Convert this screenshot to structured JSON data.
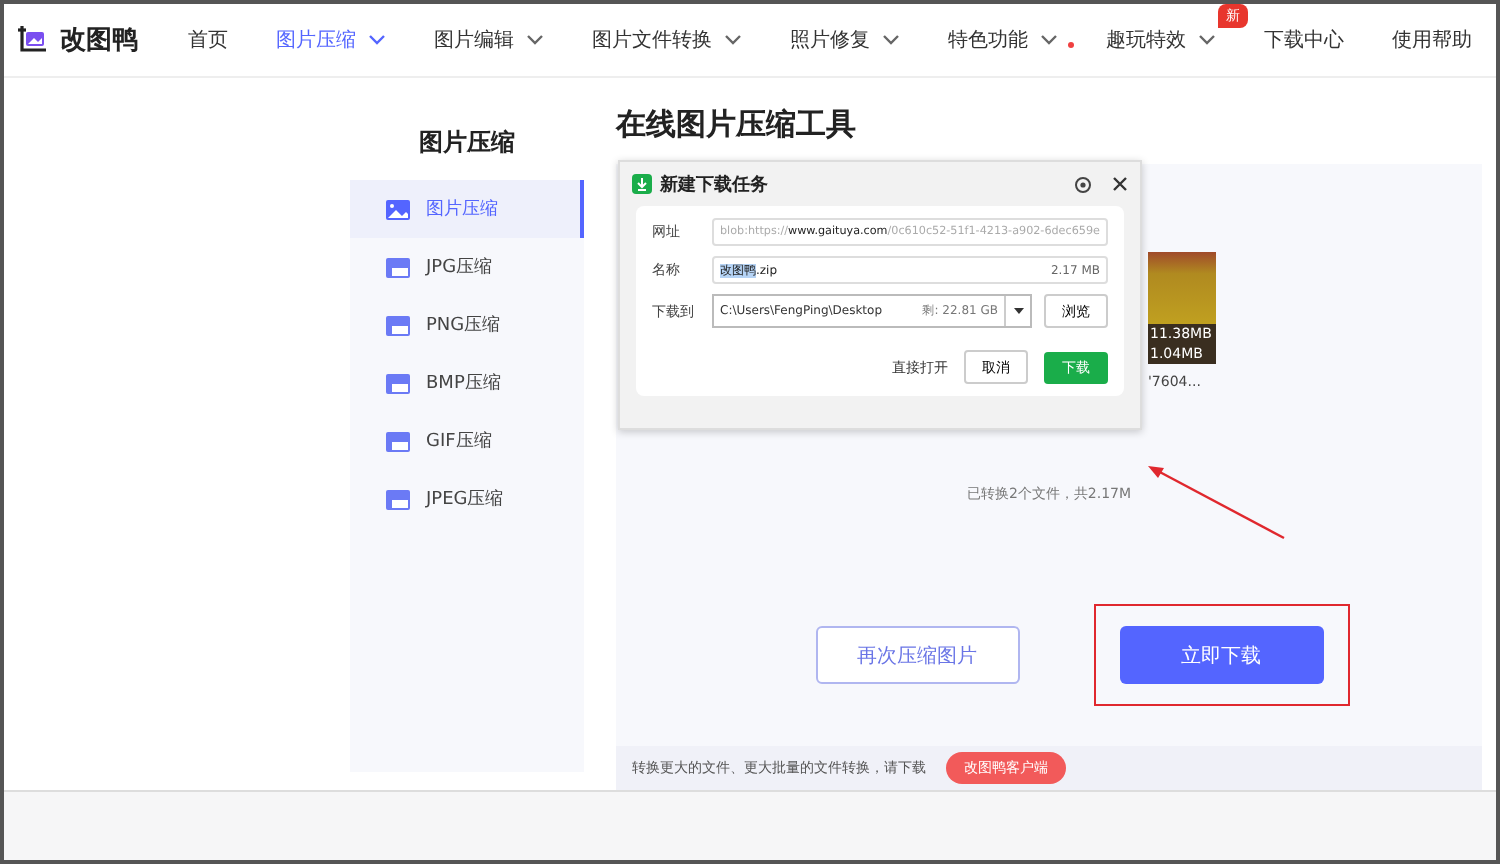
{
  "logo": {
    "text": "改图鸭"
  },
  "nav": [
    {
      "label": "首页",
      "selected": false,
      "dropdown": false
    },
    {
      "label": "图片压缩",
      "selected": true,
      "dropdown": true
    },
    {
      "label": "图片编辑",
      "selected": false,
      "dropdown": true
    },
    {
      "label": "图片文件转换",
      "selected": false,
      "dropdown": true
    },
    {
      "label": "照片修复",
      "selected": false,
      "dropdown": true
    },
    {
      "label": "特色功能",
      "selected": false,
      "dropdown": true,
      "dot": true
    },
    {
      "label": "趣玩特效",
      "selected": false,
      "dropdown": true,
      "badge": "新"
    },
    {
      "label": "下载中心",
      "selected": false,
      "dropdown": false
    },
    {
      "label": "使用帮助",
      "selected": false,
      "dropdown": false
    }
  ],
  "sidebar": {
    "title": "图片压缩",
    "items": [
      {
        "label": "图片压缩",
        "selected": true,
        "kind": "image"
      },
      {
        "label": "JPG压缩",
        "selected": false,
        "kind": "format"
      },
      {
        "label": "PNG压缩",
        "selected": false,
        "kind": "format"
      },
      {
        "label": "BMP压缩",
        "selected": false,
        "kind": "format"
      },
      {
        "label": "GIF压缩",
        "selected": false,
        "kind": "format"
      },
      {
        "label": "JPEG压缩",
        "selected": false,
        "kind": "format"
      }
    ]
  },
  "main": {
    "title": "在线图片压缩工具",
    "thumbnail": {
      "sizes": [
        "11.38MB",
        "1.04MB"
      ],
      "caption": "'7604..."
    },
    "summary": "已转换2个文件，共2.17M",
    "buttons": [
      {
        "label": "再次压缩图片",
        "kind": "secondary",
        "highlighted": false
      },
      {
        "label": "立即下载",
        "kind": "primary",
        "highlighted": true
      }
    ],
    "footer": {
      "text": "转换更大的文件、更大批量的文件转换，请下载",
      "button": "改图鸭客户端"
    }
  },
  "dialog": {
    "title": "新建下载任务",
    "url_label": "网址",
    "url": "blob:https://**www.gaituya.com**/0c610c52-51f1-4213-a902-6dec659e",
    "name_label": "名称",
    "name_selected": "改图鸭",
    "name_rest": ".zip",
    "size": "2.17 MB",
    "path_label": "下载到",
    "path": "C:\\Users\\FengPing\\Desktop",
    "free": "剩: 22.81 GB",
    "browse": "浏览",
    "open": "直接打开",
    "cancel": "取消",
    "download": "下载"
  }
}
